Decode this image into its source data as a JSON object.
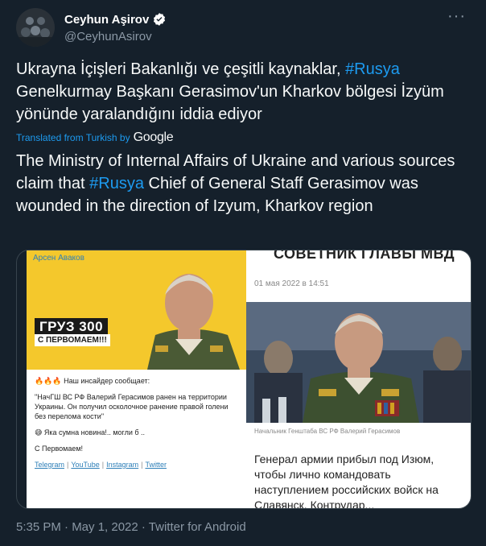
{
  "author": {
    "name": "Ceyhun Aşirov",
    "handle": "@CeyhunAsirov",
    "verified": true,
    "avatar_icon": "avatar-photo-icon"
  },
  "tweet": {
    "original_part1": "Ukrayna İçişleri Bakanlığı ve çeşitli kaynaklar, ",
    "original_hashtag": "#Rusya",
    "original_part2": " Genelkurmay Başkanı Gerasimov'un Kharkov bölgesi İzyüm yönünde yaralandığını iddia ediyor",
    "translated_label": "Translated from Turkish by",
    "translated_by": "Google",
    "translation_part1": "The Ministry of Internal Affairs of Ukraine and various sources claim that ",
    "translation_hashtag": "#Rusya",
    "translation_part2": " Chief of General Staff Gerasimov was wounded in the direction of Izyum, Kharkov region"
  },
  "media_left": {
    "author": "Арсен Аваков",
    "cargo": "ГРУЗ 300",
    "greeting": "С ПЕРВОМАЕМ!!!",
    "emoji_line": "🔥🔥🔥 Наш инсайдер сообщает:",
    "quote": "\"НачГШ  ВС РФ Валерий Герасимов ранен на территории Украины. Он получил осколочное ранение правой голени без перелома кости\"",
    "reaction": "😅 Яка сумна новина!.. могли б ..",
    "closing": "С Первомаем!",
    "links": [
      "Telegram",
      "YouTube",
      "Instagram",
      "Twitter"
    ]
  },
  "media_right": {
    "headline": "СОВЕТНИК ГЛАВЫ МВД",
    "date": "01 мая 2022 в 14:51",
    "caption": "Начальник Генштаба ВС РФ Валерий Герасимов",
    "body": "Генерал армии прибыл под Изюм, чтобы лично командовать наступлением российских войск на Славянск. Контрудар..."
  },
  "meta": {
    "timestamp": "5:35 PM · May 1, 2022 · Twitter for Android"
  },
  "colors": {
    "background": "#15202b",
    "accent": "#1d9bf0",
    "secondary_text": "#8b98a5"
  }
}
